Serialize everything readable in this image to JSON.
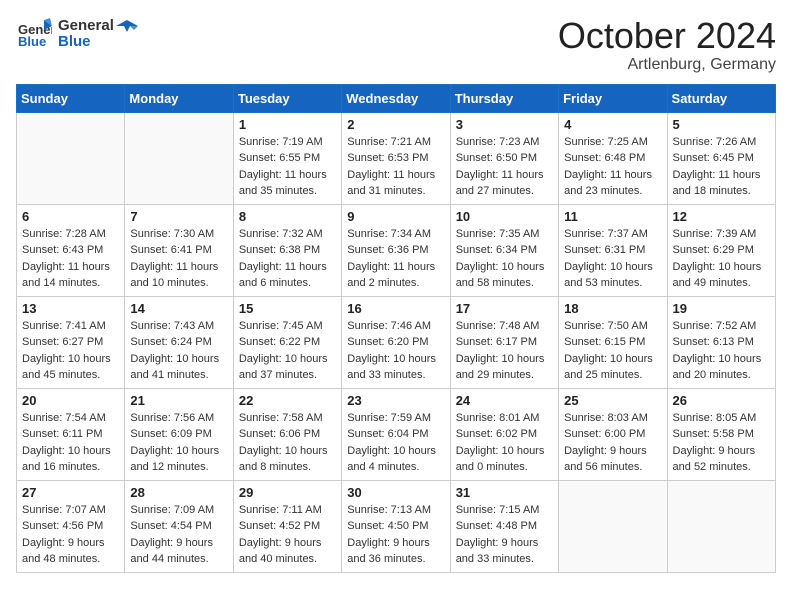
{
  "logo": {
    "general": "General",
    "blue": "Blue"
  },
  "title": "October 2024",
  "location": "Artlenburg, Germany",
  "days_of_week": [
    "Sunday",
    "Monday",
    "Tuesday",
    "Wednesday",
    "Thursday",
    "Friday",
    "Saturday"
  ],
  "weeks": [
    [
      {
        "day": "",
        "info": ""
      },
      {
        "day": "",
        "info": ""
      },
      {
        "day": "1",
        "info": "Sunrise: 7:19 AM\nSunset: 6:55 PM\nDaylight: 11 hours and 35 minutes."
      },
      {
        "day": "2",
        "info": "Sunrise: 7:21 AM\nSunset: 6:53 PM\nDaylight: 11 hours and 31 minutes."
      },
      {
        "day": "3",
        "info": "Sunrise: 7:23 AM\nSunset: 6:50 PM\nDaylight: 11 hours and 27 minutes."
      },
      {
        "day": "4",
        "info": "Sunrise: 7:25 AM\nSunset: 6:48 PM\nDaylight: 11 hours and 23 minutes."
      },
      {
        "day": "5",
        "info": "Sunrise: 7:26 AM\nSunset: 6:45 PM\nDaylight: 11 hours and 18 minutes."
      }
    ],
    [
      {
        "day": "6",
        "info": "Sunrise: 7:28 AM\nSunset: 6:43 PM\nDaylight: 11 hours and 14 minutes."
      },
      {
        "day": "7",
        "info": "Sunrise: 7:30 AM\nSunset: 6:41 PM\nDaylight: 11 hours and 10 minutes."
      },
      {
        "day": "8",
        "info": "Sunrise: 7:32 AM\nSunset: 6:38 PM\nDaylight: 11 hours and 6 minutes."
      },
      {
        "day": "9",
        "info": "Sunrise: 7:34 AM\nSunset: 6:36 PM\nDaylight: 11 hours and 2 minutes."
      },
      {
        "day": "10",
        "info": "Sunrise: 7:35 AM\nSunset: 6:34 PM\nDaylight: 10 hours and 58 minutes."
      },
      {
        "day": "11",
        "info": "Sunrise: 7:37 AM\nSunset: 6:31 PM\nDaylight: 10 hours and 53 minutes."
      },
      {
        "day": "12",
        "info": "Sunrise: 7:39 AM\nSunset: 6:29 PM\nDaylight: 10 hours and 49 minutes."
      }
    ],
    [
      {
        "day": "13",
        "info": "Sunrise: 7:41 AM\nSunset: 6:27 PM\nDaylight: 10 hours and 45 minutes."
      },
      {
        "day": "14",
        "info": "Sunrise: 7:43 AM\nSunset: 6:24 PM\nDaylight: 10 hours and 41 minutes."
      },
      {
        "day": "15",
        "info": "Sunrise: 7:45 AM\nSunset: 6:22 PM\nDaylight: 10 hours and 37 minutes."
      },
      {
        "day": "16",
        "info": "Sunrise: 7:46 AM\nSunset: 6:20 PM\nDaylight: 10 hours and 33 minutes."
      },
      {
        "day": "17",
        "info": "Sunrise: 7:48 AM\nSunset: 6:17 PM\nDaylight: 10 hours and 29 minutes."
      },
      {
        "day": "18",
        "info": "Sunrise: 7:50 AM\nSunset: 6:15 PM\nDaylight: 10 hours and 25 minutes."
      },
      {
        "day": "19",
        "info": "Sunrise: 7:52 AM\nSunset: 6:13 PM\nDaylight: 10 hours and 20 minutes."
      }
    ],
    [
      {
        "day": "20",
        "info": "Sunrise: 7:54 AM\nSunset: 6:11 PM\nDaylight: 10 hours and 16 minutes."
      },
      {
        "day": "21",
        "info": "Sunrise: 7:56 AM\nSunset: 6:09 PM\nDaylight: 10 hours and 12 minutes."
      },
      {
        "day": "22",
        "info": "Sunrise: 7:58 AM\nSunset: 6:06 PM\nDaylight: 10 hours and 8 minutes."
      },
      {
        "day": "23",
        "info": "Sunrise: 7:59 AM\nSunset: 6:04 PM\nDaylight: 10 hours and 4 minutes."
      },
      {
        "day": "24",
        "info": "Sunrise: 8:01 AM\nSunset: 6:02 PM\nDaylight: 10 hours and 0 minutes."
      },
      {
        "day": "25",
        "info": "Sunrise: 8:03 AM\nSunset: 6:00 PM\nDaylight: 9 hours and 56 minutes."
      },
      {
        "day": "26",
        "info": "Sunrise: 8:05 AM\nSunset: 5:58 PM\nDaylight: 9 hours and 52 minutes."
      }
    ],
    [
      {
        "day": "27",
        "info": "Sunrise: 7:07 AM\nSunset: 4:56 PM\nDaylight: 9 hours and 48 minutes."
      },
      {
        "day": "28",
        "info": "Sunrise: 7:09 AM\nSunset: 4:54 PM\nDaylight: 9 hours and 44 minutes."
      },
      {
        "day": "29",
        "info": "Sunrise: 7:11 AM\nSunset: 4:52 PM\nDaylight: 9 hours and 40 minutes."
      },
      {
        "day": "30",
        "info": "Sunrise: 7:13 AM\nSunset: 4:50 PM\nDaylight: 9 hours and 36 minutes."
      },
      {
        "day": "31",
        "info": "Sunrise: 7:15 AM\nSunset: 4:48 PM\nDaylight: 9 hours and 33 minutes."
      },
      {
        "day": "",
        "info": ""
      },
      {
        "day": "",
        "info": ""
      }
    ]
  ]
}
